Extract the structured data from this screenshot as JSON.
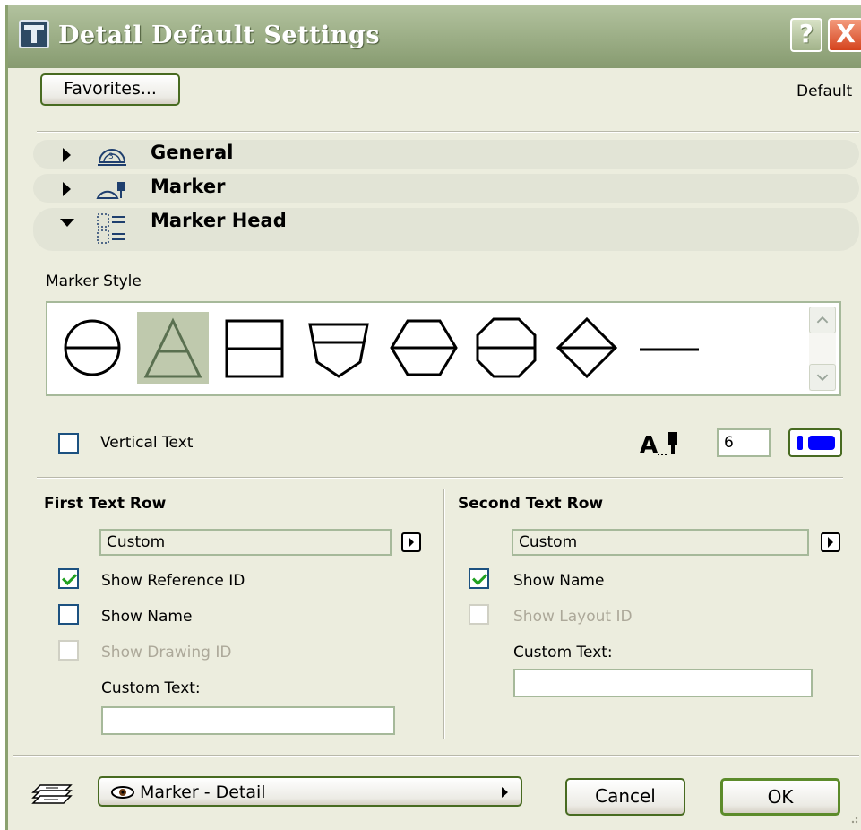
{
  "window": {
    "title": "Detail Default Settings",
    "help_label": "?",
    "close_label": "X"
  },
  "toolbar": {
    "favorites_label": "Favorites...",
    "default_label": "Default"
  },
  "sections": [
    {
      "label": "General",
      "expanded": false,
      "icon": "general-icon"
    },
    {
      "label": "Marker",
      "expanded": false,
      "icon": "marker-icon"
    },
    {
      "label": "Marker Head",
      "expanded": true,
      "icon": "marker-head-icon"
    }
  ],
  "marker_style": {
    "label": "Marker Style",
    "options": [
      "circle",
      "triangle",
      "square",
      "pentagon",
      "hexagon",
      "octagon",
      "diamond",
      "line"
    ],
    "selected": "triangle"
  },
  "vertical_text": {
    "label": "Vertical Text",
    "checked": false
  },
  "font": {
    "icon": "text-pen-icon",
    "size_value": "6",
    "pen_color": "#0000ff"
  },
  "first_row": {
    "heading": "First Text Row",
    "select_value": "Custom",
    "show_reference_id": {
      "label": "Show Reference ID",
      "checked": true
    },
    "show_name": {
      "label": "Show Name",
      "checked": false
    },
    "show_drawing_id": {
      "label": "Show Drawing ID",
      "checked": false,
      "disabled": true
    },
    "custom_text_label": "Custom Text:",
    "custom_text_value": ""
  },
  "second_row": {
    "heading": "Second Text Row",
    "select_value": "Custom",
    "show_name": {
      "label": "Show Name",
      "checked": true
    },
    "show_layout_id": {
      "label": "Show Layout ID",
      "checked": false,
      "disabled": true
    },
    "custom_text_label": "Custom Text:",
    "custom_text_value": ""
  },
  "footer": {
    "layer_label": "Marker - Detail",
    "cancel_label": "Cancel",
    "ok_label": "OK"
  }
}
